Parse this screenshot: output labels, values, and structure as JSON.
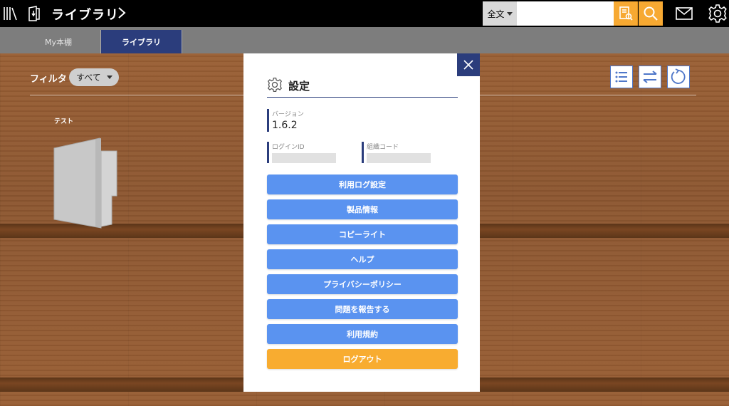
{
  "topbar": {
    "title": "ライブラリ",
    "search_scope": "全文",
    "search_placeholder": "",
    "accent_color": "#f7a932"
  },
  "tabs": [
    {
      "label": "My本棚",
      "active": false
    },
    {
      "label": "ライブラリ",
      "active": true
    }
  ],
  "filter": {
    "label": "フィルタ",
    "selected": "すべて"
  },
  "books": [
    {
      "title": "テスト"
    }
  ],
  "dialog": {
    "title": "設定",
    "version_label": "バージョン",
    "version_value": "1.6.2",
    "login_label": "ログインID",
    "org_label": "組織コード",
    "menu": [
      "利用ログ設定",
      "製品情報",
      "コピーライト",
      "ヘルプ",
      "プライバシーポリシー",
      "問題を報告する",
      "利用規約"
    ],
    "logout_label": "ログアウト",
    "button_color": "#5a93f0",
    "logout_color": "#f8ac30",
    "header_color": "#2b3d7c"
  }
}
